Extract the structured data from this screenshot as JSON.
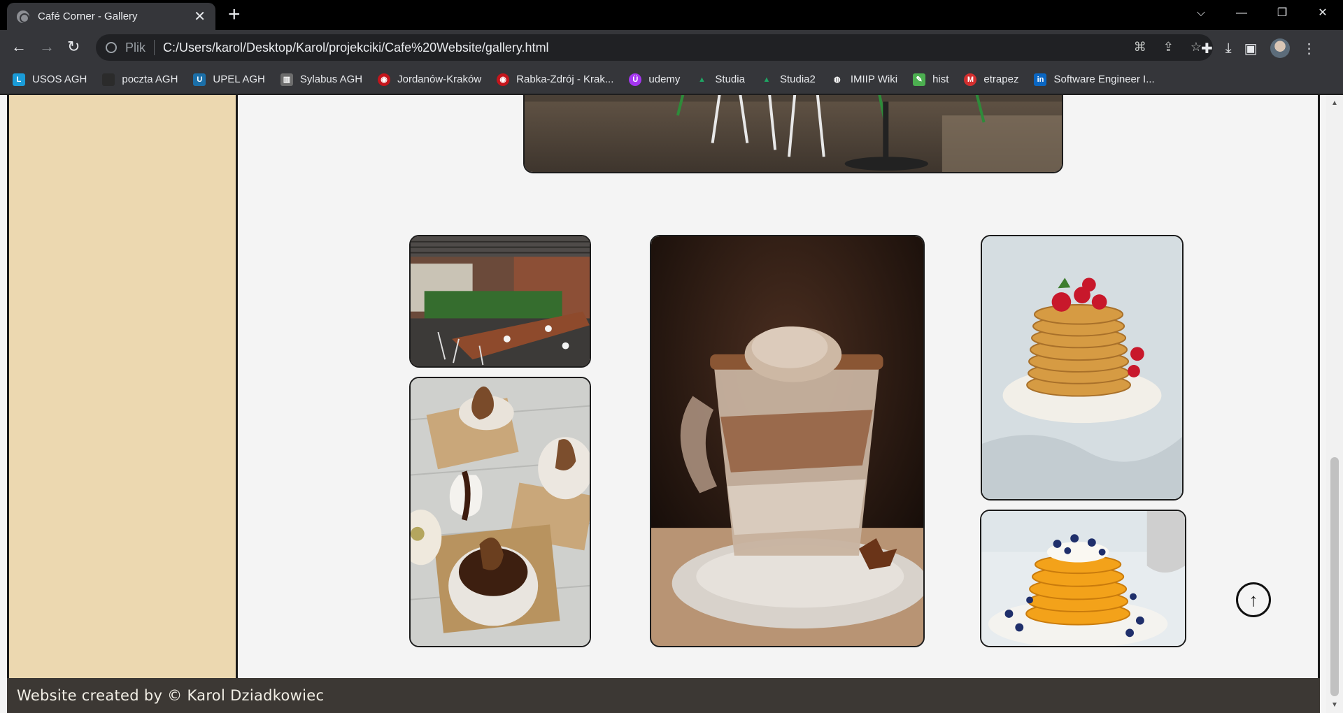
{
  "browser": {
    "tab_title": "Café Corner - Gallery",
    "tab_close": "✕",
    "new_tab": "+",
    "window_controls": [
      "⌵",
      "—",
      "❐",
      "✕"
    ],
    "address_prefix": "Plik",
    "url": "C:/Users/karol/Desktop/Karol/projekciki/Cafe%20Website/gallery.html",
    "bookmarks": [
      {
        "label": "USOS AGH",
        "icon": "L",
        "color": "#1a9bd7"
      },
      {
        "label": "poczta AGH",
        "icon": "",
        "color": "#2b2b2b"
      },
      {
        "label": "UPEL AGH",
        "icon": "U",
        "color": "#1b6fa8"
      },
      {
        "label": "Sylabus AGH",
        "icon": "▥",
        "color": "#6d6d6d"
      },
      {
        "label": "Jordanów-Kraków",
        "icon": "◉",
        "color": "#c4151c"
      },
      {
        "label": "Rabka-Zdrój - Krak...",
        "icon": "◉",
        "color": "#c4151c"
      },
      {
        "label": "udemy",
        "icon": "Ü",
        "color": "#a435f0"
      },
      {
        "label": "Studia",
        "icon": "▲",
        "color": "#1fa463"
      },
      {
        "label": "Studia2",
        "icon": "▲",
        "color": "#1fa463"
      },
      {
        "label": "IMIIP Wiki",
        "icon": "◍",
        "color": "#ffffff"
      },
      {
        "label": "hist",
        "icon": "✎",
        "color": "#4caf50"
      },
      {
        "label": "etrapez",
        "icon": "M",
        "color": "#d32f2f"
      },
      {
        "label": "Software Engineer I...",
        "icon": "in",
        "color": "#0a66c2"
      }
    ]
  },
  "page": {
    "footer_text": "Website created by © Karol Dziadkowiec",
    "back_to_top_icon": "↑",
    "gallery": [
      {
        "name": "cafe-interior"
      },
      {
        "name": "terrace-dining"
      },
      {
        "name": "chocolate-pear-dessert"
      },
      {
        "name": "iced-coffee-with-ice-cream"
      },
      {
        "name": "strawberry-pancakes"
      },
      {
        "name": "blueberry-pancakes"
      }
    ]
  }
}
